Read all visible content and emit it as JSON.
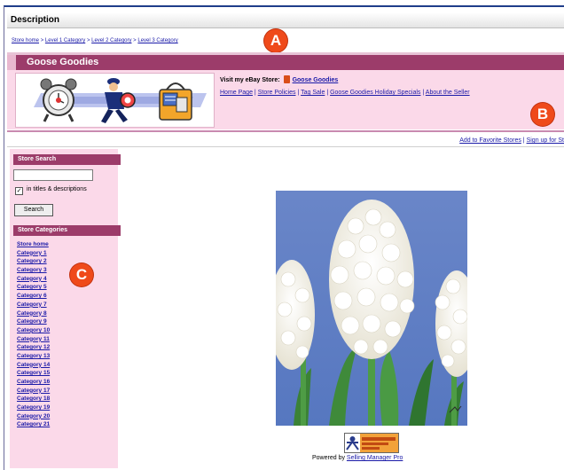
{
  "description_label": "Description",
  "breadcrumb": [
    "Store home",
    "Level 1 Category",
    "Level 2 Category",
    "Level 3 Category"
  ],
  "breadcrumb_sep": ">",
  "store_name": "Goose Goodies",
  "visit": {
    "label": "Visit my eBay Store:",
    "store_link": "Goose Goodies"
  },
  "nav_links": [
    "Home Page",
    "Store Policies",
    "Tag Sale",
    "Goose Goodies Holiday Specials",
    "About the Seller"
  ],
  "nav_sep": "|",
  "fav_links": {
    "add": "Add to Favorite Stores",
    "sep": "|",
    "signup": "Sign up for St"
  },
  "store_search": {
    "heading": "Store Search",
    "input_value": "",
    "checkbox_label": "in titles & descriptions",
    "checkbox_mark": "✓",
    "button": "Search"
  },
  "store_categories": {
    "heading": "Store Categories",
    "items": [
      "Store home",
      "Category 1",
      "Category 2",
      "Category 3",
      "Category 4",
      "Category 5",
      "Category 6",
      "Category 7",
      "Category 8",
      "Category 9",
      "Category 10",
      "Category 11",
      "Category 12",
      "Category 13",
      "Category 14",
      "Category 15",
      "Category 16",
      "Category 17",
      "Category 18",
      "Category 19",
      "Category 20",
      "Category 21"
    ]
  },
  "markers": {
    "a": "A",
    "b": "B",
    "c": "C"
  },
  "powered": {
    "prefix": "Powered by",
    "link": "Selling Manager Pro"
  },
  "colors": {
    "store_header": "#9c3c6a",
    "pink_band": "#fbd9e9",
    "marker": "#ef4a1a",
    "link": "#1a1aa8"
  }
}
